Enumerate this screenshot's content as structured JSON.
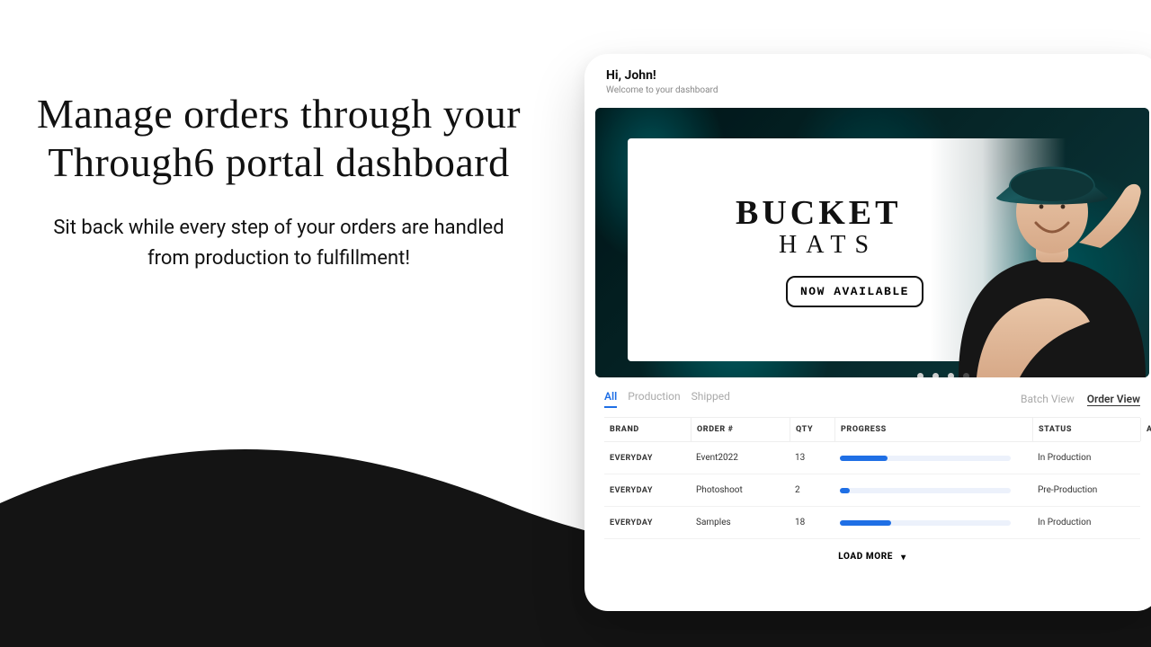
{
  "marketing": {
    "headline": "Manage orders through your Through6 portal dashboard",
    "subhead": "Sit back while every step of your orders are handled from production to fulfillment!"
  },
  "dashboard": {
    "greeting": "Hi, John!",
    "welcome": "Welcome to your dashboard",
    "banner": {
      "title": "BUCKET",
      "subtitle": "HATS",
      "cta": "NOW AVAILABLE",
      "dots_total": 4,
      "dots_active_index": 3
    },
    "tabs": [
      {
        "label": "All",
        "active": true
      },
      {
        "label": "Production",
        "active": false
      },
      {
        "label": "Shipped",
        "active": false
      }
    ],
    "views": [
      {
        "label": "Batch View",
        "active": false
      },
      {
        "label": "Order View",
        "active": true
      }
    ],
    "columns": {
      "brand": "BRAND",
      "order": "ORDER #",
      "qty": "QTY",
      "progress": "PROGRESS",
      "status": "STATUS",
      "alerts": "ALERTS"
    },
    "rows": [
      {
        "brand": "EVERYDAY",
        "order": "Event2022",
        "qty": "13",
        "progress_pct": 28,
        "status": "In Production"
      },
      {
        "brand": "EVERYDAY",
        "order": "Photoshoot",
        "qty": "2",
        "progress_pct": 6,
        "status": "Pre-Production"
      },
      {
        "brand": "EVERYDAY",
        "order": "Samples",
        "qty": "18",
        "progress_pct": 30,
        "status": "In Production"
      }
    ],
    "load_more": "LOAD MORE"
  }
}
